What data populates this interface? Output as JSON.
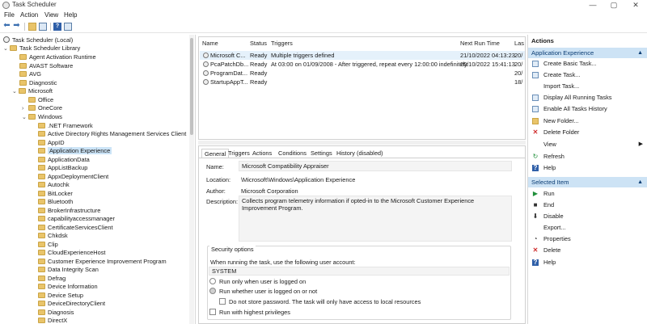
{
  "window": {
    "title": "Task Scheduler",
    "controls": {
      "minimize": "—",
      "maximize": "▢",
      "close": "✕"
    }
  },
  "menu": [
    "File",
    "Action",
    "View",
    "Help"
  ],
  "toolbar": {
    "back": "⬅",
    "forward": "➡"
  },
  "tree": {
    "root": "Task Scheduler (Local)",
    "library": "Task Scheduler Library",
    "items": [
      "Agent Activation Runtime",
      "AVAST Software",
      "AVG",
      "Diagnostic",
      "Microsoft",
      "Office",
      "OneCore",
      "Windows",
      ".NET Framework",
      "Active Directory Rights Management Services Client",
      "AppID",
      "Application Experience",
      "ApplicationData",
      "AppListBackup",
      "AppxDeploymentClient",
      "Autochk",
      "BitLocker",
      "Bluetooth",
      "BrokerInfrastructure",
      "capabilityaccessmanager",
      "CertificateServicesClient",
      "Chkdsk",
      "Clip",
      "CloudExperienceHost",
      "Customer Experience Improvement Program",
      "Data Integrity Scan",
      "Defrag",
      "Device Information",
      "Device Setup",
      "DeviceDirectoryClient",
      "Diagnosis",
      "DirectX"
    ]
  },
  "tasks": {
    "columns": [
      "Name",
      "Status",
      "Triggers",
      "Next Run Time",
      "Las"
    ],
    "rows": [
      {
        "name": "Microsoft C...",
        "status": "Ready",
        "triggers": "Multiple triggers defined",
        "next": "21/10/2022 04:13:23",
        "last": "20/"
      },
      {
        "name": "PcaPatchDb...",
        "status": "Ready",
        "triggers": "At 03:00 on 01/09/2008 - After triggered, repeat every 12:00:00 indefinitely.",
        "next": "20/10/2022 15:41:13",
        "last": "20/"
      },
      {
        "name": "ProgramDat...",
        "status": "Ready",
        "triggers": "",
        "next": "",
        "last": "20/"
      },
      {
        "name": "StartupAppT...",
        "status": "Ready",
        "triggers": "",
        "next": "",
        "last": "18/"
      }
    ]
  },
  "details": {
    "tabs": [
      "General",
      "Triggers",
      "Actions",
      "Conditions",
      "Settings",
      "History (disabled)"
    ],
    "name_label": "Name:",
    "name_value": "Microsoft Compatibility Appraiser",
    "location_label": "Location:",
    "location_value": "\\Microsoft\\Windows\\Application Experience",
    "author_label": "Author:",
    "author_value": "Microsoft Corporation",
    "description_label": "Description:",
    "description_value": "Collects program telemetry information if opted-in to the Microsoft Customer Experience Improvement Program.",
    "security": {
      "title": "Security options",
      "account_prompt": "When running the task, use the following user account:",
      "account": "SYSTEM",
      "opt_logged_on": "Run only when user is logged on",
      "opt_whether": "Run whether user is logged on or not",
      "opt_no_password": "Do not store password.  The task will only have access to local resources",
      "opt_highest": "Run with highest privileges"
    }
  },
  "actions": {
    "header": "Actions",
    "section1": "Application Experience",
    "items1": [
      {
        "label": "Create Basic Task...",
        "icon": "create-basic-task-icon"
      },
      {
        "label": "Create Task...",
        "icon": "create-task-icon"
      },
      {
        "label": "Import Task...",
        "icon": ""
      },
      {
        "label": "Display All Running Tasks",
        "icon": "running-tasks-icon"
      },
      {
        "label": "Enable All Tasks History",
        "icon": "history-icon"
      },
      {
        "label": "New Folder...",
        "icon": "new-folder-icon"
      },
      {
        "label": "Delete Folder",
        "icon": "delete-icon"
      },
      {
        "label": "View",
        "icon": ""
      },
      {
        "label": "Refresh",
        "icon": "refresh-icon"
      },
      {
        "label": "Help",
        "icon": "help-icon"
      }
    ],
    "section2": "Selected Item",
    "items2": [
      {
        "label": "Run",
        "icon": "run-icon"
      },
      {
        "label": "End",
        "icon": "end-icon"
      },
      {
        "label": "Disable",
        "icon": "disable-icon"
      },
      {
        "label": "Export...",
        "icon": ""
      },
      {
        "label": "Properties",
        "icon": "properties-icon"
      },
      {
        "label": "Delete",
        "icon": "delete-icon"
      },
      {
        "label": "Help",
        "icon": "help-icon"
      }
    ]
  }
}
